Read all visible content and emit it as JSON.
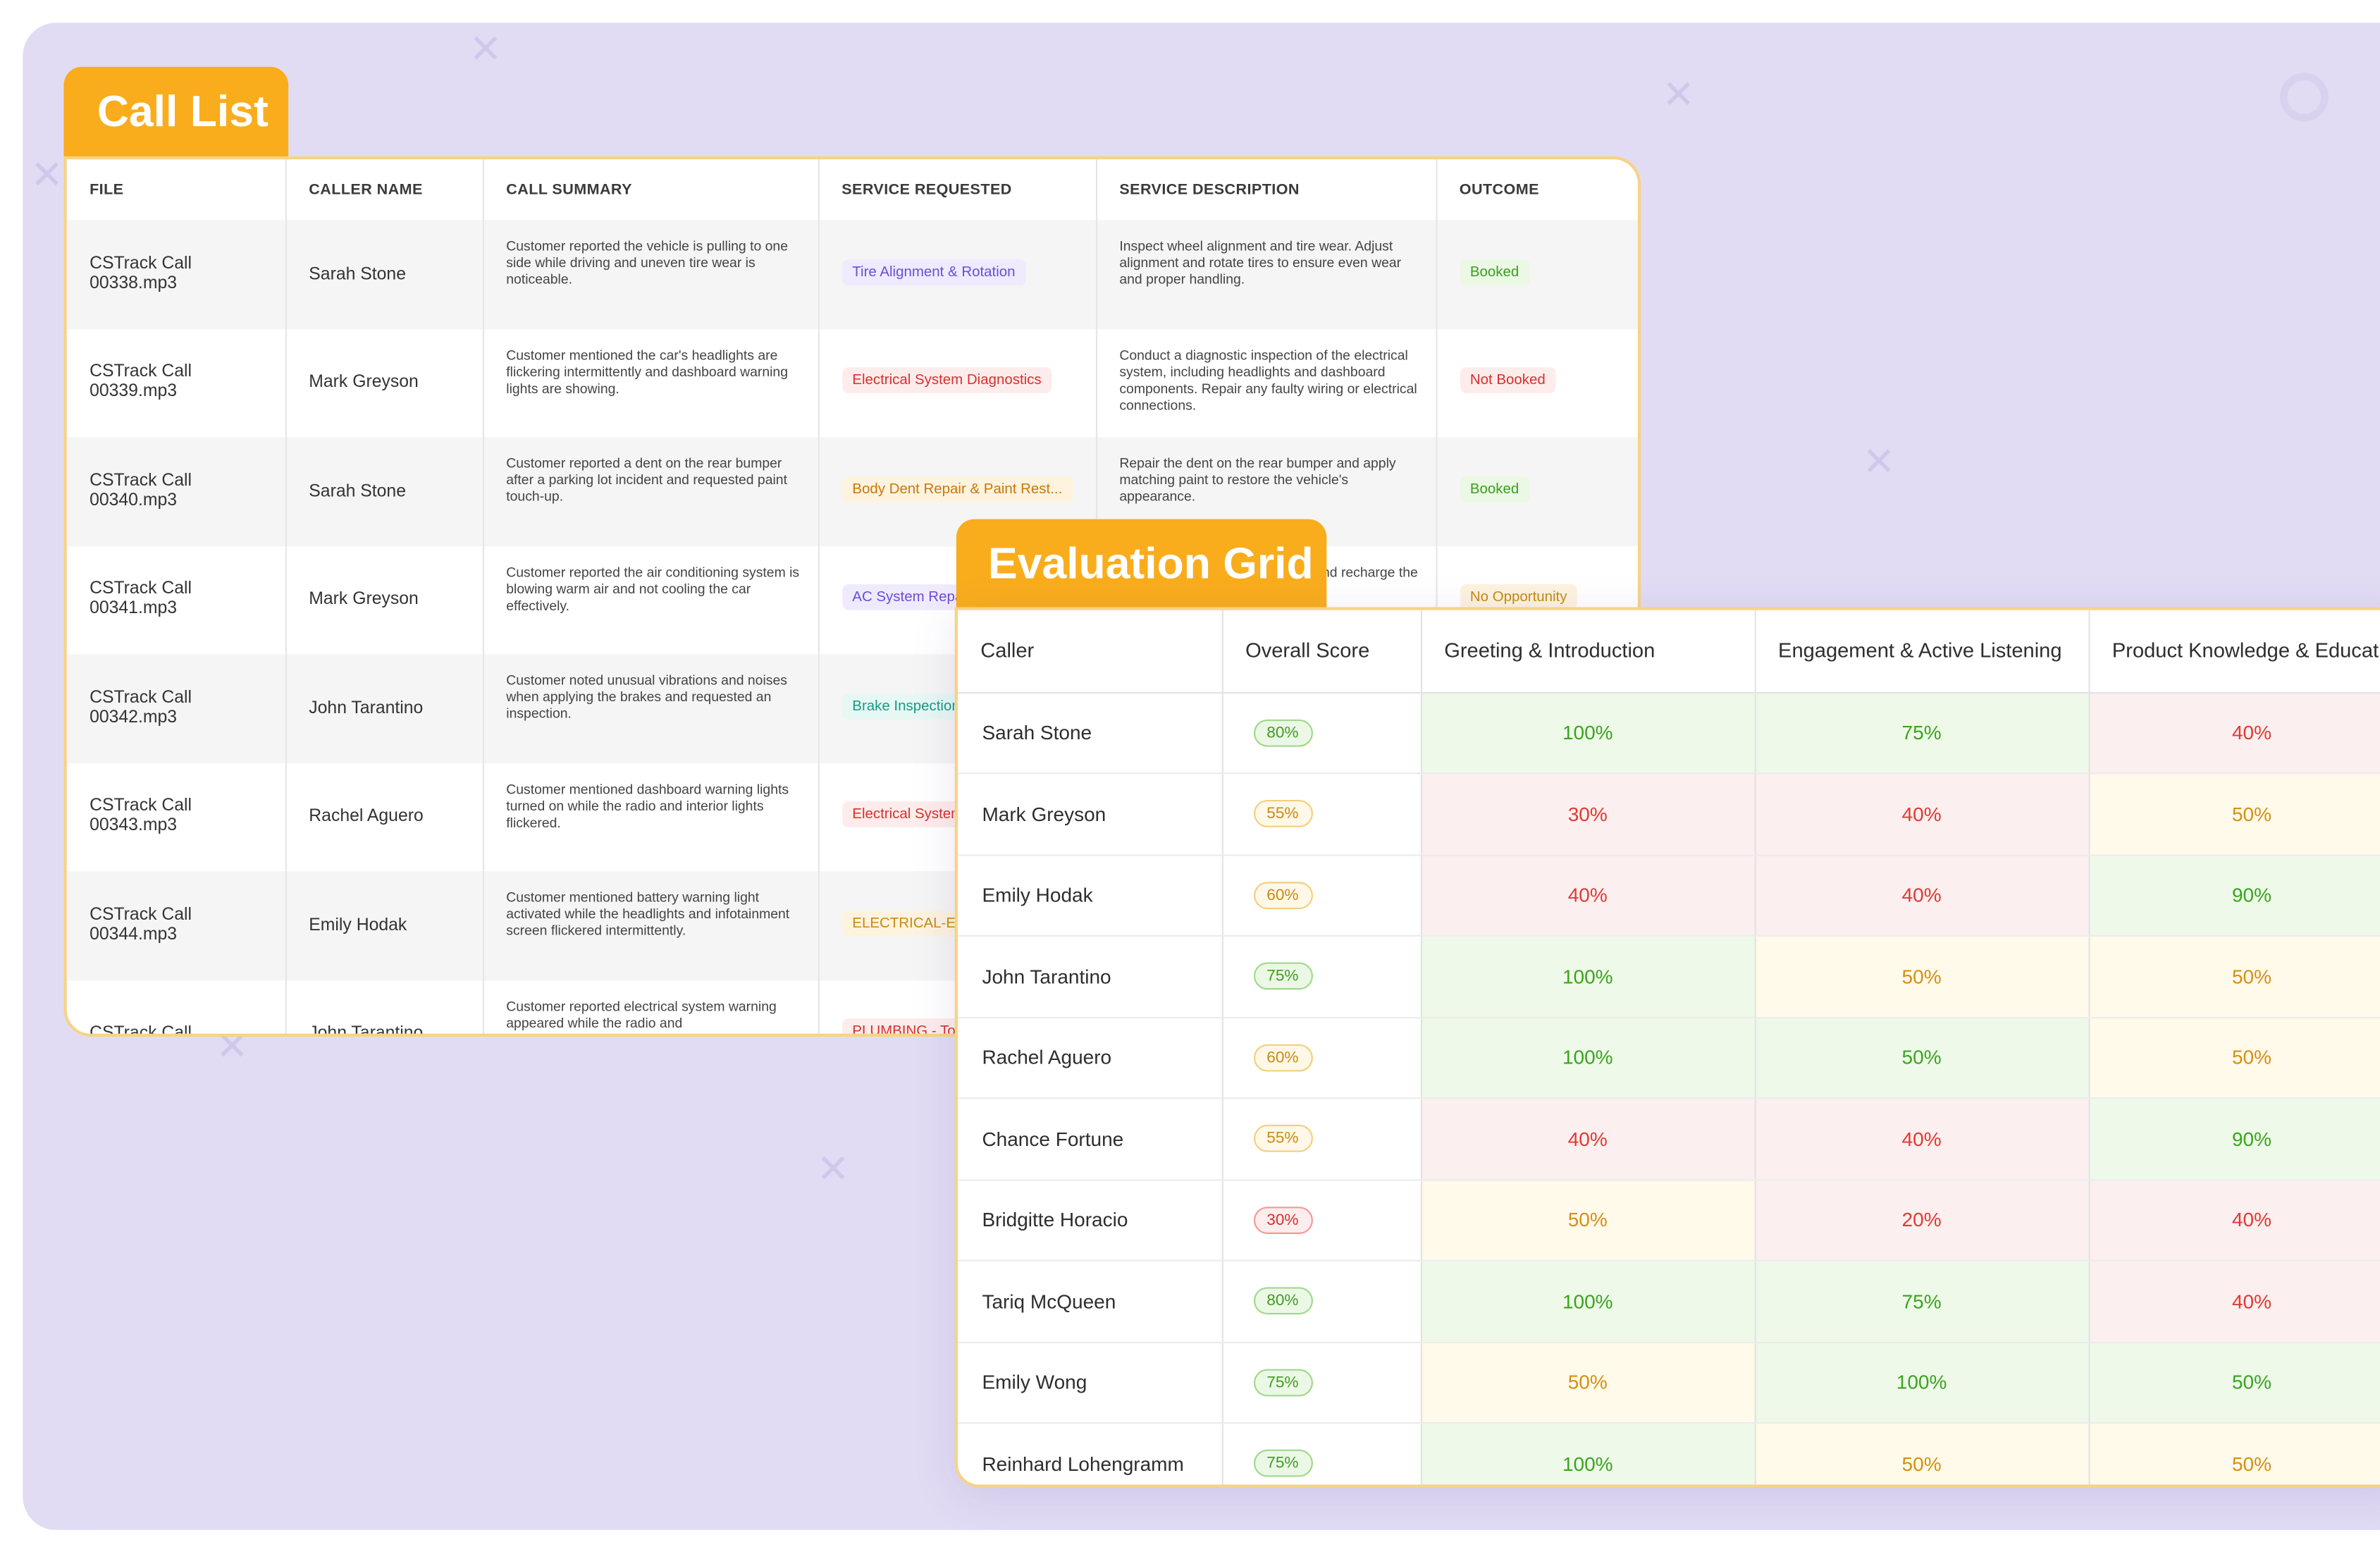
{
  "call_list": {
    "title": "Call List",
    "columns": [
      "FILE",
      "CALLER NAME",
      "CALL SUMMARY",
      "SERVICE REQUESTED",
      "SERVICE DESCRIPTION",
      "OUTCOME"
    ],
    "rows": [
      {
        "file": "CSTrack Call 00338.mp3",
        "caller": "Sarah Stone",
        "summary": "Customer reported the vehicle is pulling to one side while driving and uneven tire wear is noticeable.",
        "service": "Tire Alignment & Rotation",
        "service_color": "purple",
        "description": "Inspect wheel alignment and tire wear. Adjust alignment and rotate tires to ensure even wear and proper handling.",
        "outcome": "Booked",
        "outcome_color": "booked"
      },
      {
        "file": "CSTrack Call 00339.mp3",
        "caller": "Mark Greyson",
        "summary": "Customer mentioned the car's headlights are flickering intermittently and dashboard warning lights are showing.",
        "service": "Electrical System Diagnostics",
        "service_color": "red",
        "description": "Conduct a diagnostic inspection of the electrical system, including headlights and dashboard components. Repair any faulty wiring or electrical connections.",
        "outcome": "Not Booked",
        "outcome_color": "not"
      },
      {
        "file": "CSTrack Call 00340.mp3",
        "caller": "Sarah Stone",
        "summary": "Customer reported a dent on the rear bumper after a parking lot incident and requested paint touch-up.",
        "service": "Body Dent Repair & Paint Rest...",
        "service_color": "orange",
        "description": "Repair the dent on the rear bumper and apply matching paint to restore the vehicle's appearance.",
        "outcome": "Booked",
        "outcome_color": "booked"
      },
      {
        "file": "CSTrack Call 00341.mp3",
        "caller": "Mark Greyson",
        "summary": "Customer reported the air conditioning system is blowing warm air and not cooling the car effectively.",
        "service": "AC System Repair",
        "service_color": "purple",
        "description": "Inspect the AC system for leaks and recharge the refrigerant to restore cooling.",
        "outcome": "No Opportunity",
        "outcome_color": "none"
      },
      {
        "file": "CSTrack Call 00342.mp3",
        "caller": "John Tarantino",
        "summary": "Customer noted unusual vibrations and noises when applying the brakes and requested an inspection.",
        "service": "Brake Inspection",
        "service_color": "teal",
        "description": "",
        "outcome": "",
        "outcome_color": "booked"
      },
      {
        "file": "CSTrack Call 00343.mp3",
        "caller": "Rachel Aguero",
        "summary": "Customer mentioned dashboard warning lights turned on while the radio and interior lights flickered.",
        "service": "Electrical System",
        "service_color": "red",
        "description": "",
        "outcome": "",
        "outcome_color": "booked"
      },
      {
        "file": "CSTrack Call 00344.mp3",
        "caller": "Emily Hodak",
        "summary": "Customer mentioned battery warning light activated while the headlights and infotainment screen flickered intermittently.",
        "service": "ELECTRICAL-Electrical",
        "service_color": "yellow",
        "description": "",
        "outcome": "",
        "outcome_color": "booked"
      },
      {
        "file": "CSTrack Call",
        "caller": "John Tarantino",
        "summary": "Customer reported electrical system warning appeared while the radio and",
        "service": "PLUMBING - Toilet",
        "service_color": "red",
        "description": "",
        "outcome": "",
        "outcome_color": "booked"
      }
    ]
  },
  "evaluation_grid": {
    "title": "Evaluation Grid",
    "columns": [
      "Caller",
      "Overall Score",
      "Greeting & Introduction",
      "Engagement & Active Listening",
      "Product Knowledge & Education"
    ],
    "rows": [
      {
        "caller": "Sarah Stone",
        "overall": "80%",
        "overall_color": "green",
        "greeting": "100%",
        "greeting_color": "green",
        "engagement": "75%",
        "engagement_color": "green",
        "product": "40%",
        "product_color": "red"
      },
      {
        "caller": "Mark Greyson",
        "overall": "55%",
        "overall_color": "orange",
        "greeting": "30%",
        "greeting_color": "red",
        "engagement": "40%",
        "engagement_color": "red",
        "product": "50%",
        "product_color": "yellow"
      },
      {
        "caller": "Emily Hodak",
        "overall": "60%",
        "overall_color": "orange",
        "greeting": "40%",
        "greeting_color": "red",
        "engagement": "40%",
        "engagement_color": "red",
        "product": "90%",
        "product_color": "green"
      },
      {
        "caller": "John Tarantino",
        "overall": "75%",
        "overall_color": "green",
        "greeting": "100%",
        "greeting_color": "green",
        "engagement": "50%",
        "engagement_color": "yellow",
        "product": "50%",
        "product_color": "yellow"
      },
      {
        "caller": "Rachel Aguero",
        "overall": "60%",
        "overall_color": "orange",
        "greeting": "100%",
        "greeting_color": "green",
        "engagement": "50%",
        "engagement_color": "green",
        "product": "50%",
        "product_color": "yellow"
      },
      {
        "caller": "Chance Fortune",
        "overall": "55%",
        "overall_color": "orange",
        "greeting": "40%",
        "greeting_color": "red",
        "engagement": "40%",
        "engagement_color": "red",
        "product": "90%",
        "product_color": "green"
      },
      {
        "caller": "Bridgitte Horacio",
        "overall": "30%",
        "overall_color": "red",
        "greeting": "50%",
        "greeting_color": "yellow",
        "engagement": "20%",
        "engagement_color": "red",
        "product": "40%",
        "product_color": "red"
      },
      {
        "caller": "Tariq McQueen",
        "overall": "80%",
        "overall_color": "green",
        "greeting": "100%",
        "greeting_color": "green",
        "engagement": "75%",
        "engagement_color": "green",
        "product": "40%",
        "product_color": "red"
      },
      {
        "caller": "Emily Wong",
        "overall": "75%",
        "overall_color": "green",
        "greeting": "50%",
        "greeting_color": "yellow",
        "engagement": "100%",
        "engagement_color": "green",
        "product": "50%",
        "product_color": "green"
      },
      {
        "caller": "Reinhard Lohengramm",
        "overall": "75%",
        "overall_color": "green",
        "greeting": "100%",
        "greeting_color": "green",
        "engagement": "50%",
        "engagement_color": "yellow",
        "product": "50%",
        "product_color": "yellow"
      }
    ]
  },
  "colors": {
    "accent": "#f9ad1d",
    "background": "#e1dcf4",
    "success": "#3d9e21",
    "danger": "#d9302c",
    "warning": "#c98a10"
  },
  "decorations": [
    "close-x-icon",
    "ring-icon"
  ]
}
